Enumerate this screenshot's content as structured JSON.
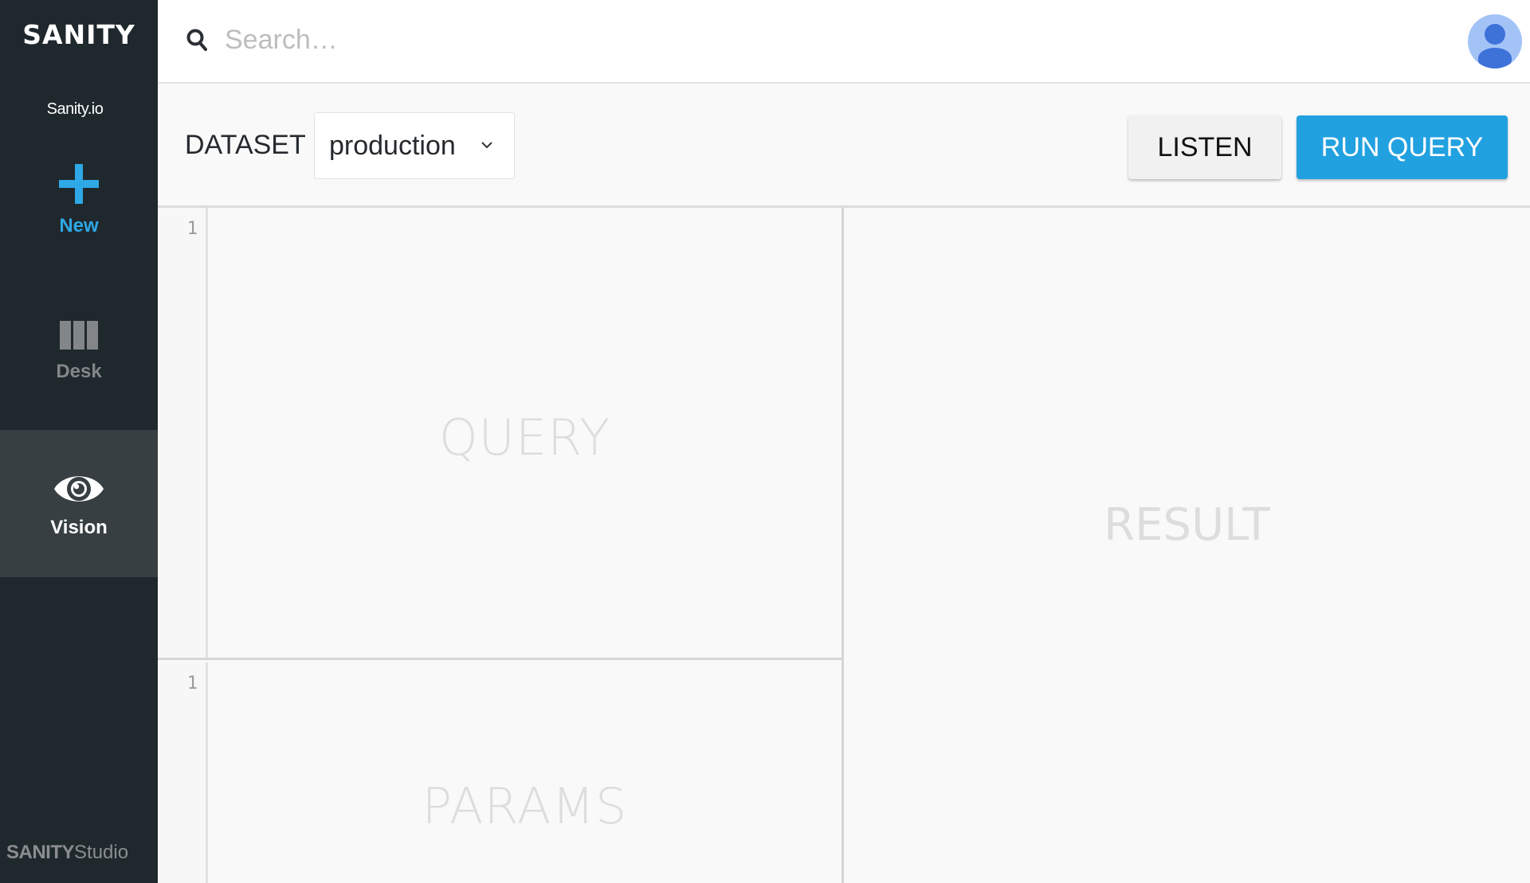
{
  "sidebar": {
    "brand": "SANITY",
    "project_name": "Sanity.io",
    "items": [
      {
        "label": "New",
        "icon": "plus-icon",
        "color": "#2ea8e6"
      },
      {
        "label": "Desk",
        "icon": "columns-icon",
        "color": "#838689"
      },
      {
        "label": "Vision",
        "icon": "eye-icon",
        "color": "#ffffff",
        "active": true
      }
    ],
    "footer": {
      "brand": "SANITY",
      "product": "Studio"
    }
  },
  "header": {
    "search": {
      "placeholder": "Search…",
      "value": ""
    },
    "avatar": "user-avatar-icon"
  },
  "toolbar": {
    "dataset_label": "DATASET",
    "dataset_selected": "production",
    "listen_label": "LISTEN",
    "run_query_label": "RUN QUERY",
    "accent_color": "#22a1e0"
  },
  "editors": {
    "query": {
      "line_number": "1",
      "placeholder": "QUERY",
      "value": ""
    },
    "params": {
      "line_number": "1",
      "placeholder": "PARAMS",
      "value": ""
    }
  },
  "result": {
    "placeholder": "RESULT"
  }
}
